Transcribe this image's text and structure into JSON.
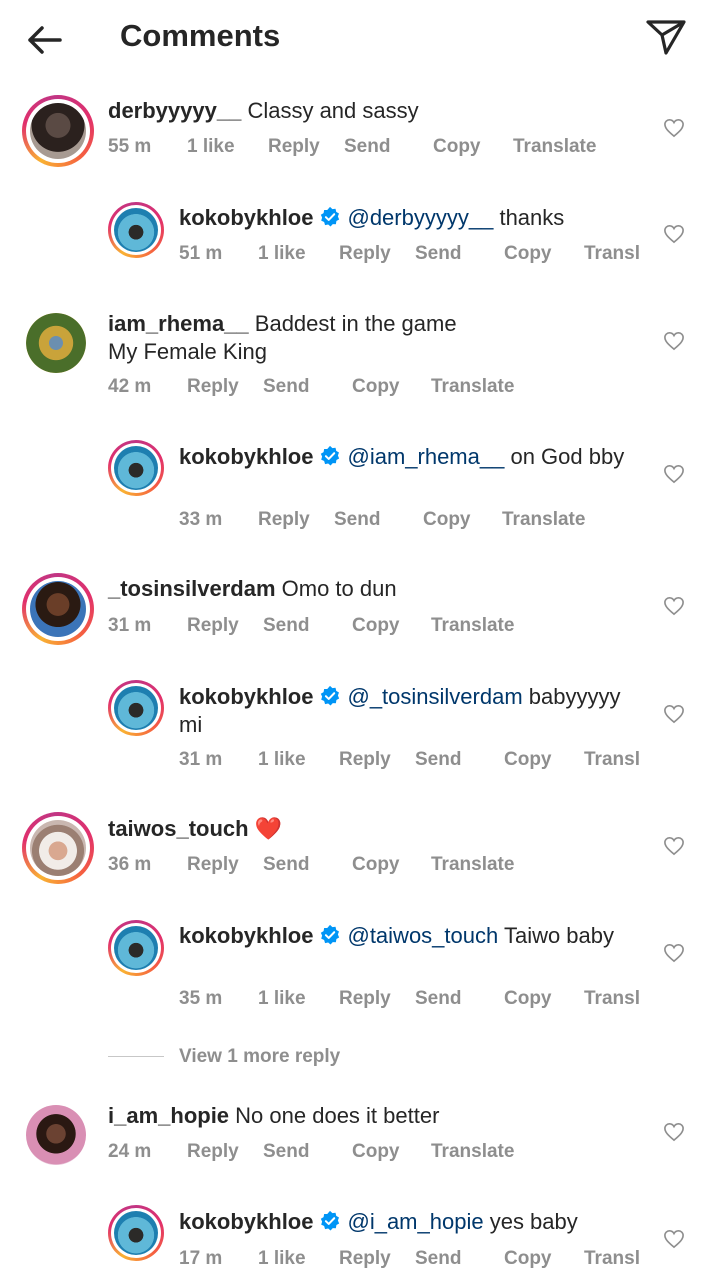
{
  "header": {
    "title": "Comments",
    "back_icon": "arrow-left-icon",
    "share_icon": "paper-plane-icon"
  },
  "colors": {
    "text": "#262626",
    "muted": "#8e8e8e",
    "mention": "#00376b",
    "verified": "#0095f6",
    "heart_red": "#ed4956"
  },
  "comments": [
    {
      "username": "derbyyyyy__",
      "text": "Classy and sassy",
      "time": "55 m",
      "likes": "1 like",
      "actions": [
        "Reply",
        "Send",
        "Copy",
        "Translate"
      ]
    },
    {
      "username": "kokobykhloe",
      "mention": "@derbyyyyy__",
      "text": "thanks",
      "time": "51 m",
      "likes": "1 like",
      "actions": [
        "Reply",
        "Send",
        "Copy",
        "Transl"
      ]
    },
    {
      "username": "iam_rhema__",
      "text": "Baddest in the game",
      "text2": "My Female King",
      "time": "42 m",
      "actions": [
        "Reply",
        "Send",
        "Copy",
        "Translate"
      ]
    },
    {
      "username": "kokobykhloe",
      "mention": "@iam_rhema__",
      "text": "on God bby",
      "time": "33 m",
      "actions": [
        "Reply",
        "Send",
        "Copy",
        "Translate"
      ]
    },
    {
      "username": "_tosinsilverdam",
      "text": "Omo to dun",
      "time": "31 m",
      "actions": [
        "Reply",
        "Send",
        "Copy",
        "Translate"
      ]
    },
    {
      "username": "kokobykhloe",
      "mention": "@_tosinsilverdam",
      "text": "babyyyyy",
      "text2": "mi",
      "time": "31 m",
      "likes": "1 like",
      "actions": [
        "Reply",
        "Send",
        "Copy",
        "Transl"
      ]
    },
    {
      "username": "taiwos_touch",
      "text": "❤️",
      "time": "36 m",
      "actions": [
        "Reply",
        "Send",
        "Copy",
        "Translate"
      ]
    },
    {
      "username": "kokobykhloe",
      "mention": "@taiwos_touch",
      "text": "Taiwo baby",
      "time": "35 m",
      "likes": "1 like",
      "actions": [
        "Reply",
        "Send",
        "Copy",
        "Transl"
      ]
    },
    {
      "username": "i_am_hopie",
      "text": "No one does it better",
      "time": "24 m",
      "actions": [
        "Reply",
        "Send",
        "Copy",
        "Translate"
      ]
    },
    {
      "username": "kokobykhloe",
      "mention": "@i_am_hopie",
      "text": "yes baby",
      "time": "17 m",
      "likes": "1 like",
      "actions": [
        "Reply",
        "Send",
        "Copy",
        "Transl"
      ]
    }
  ],
  "view_more": "View 1 more reply"
}
